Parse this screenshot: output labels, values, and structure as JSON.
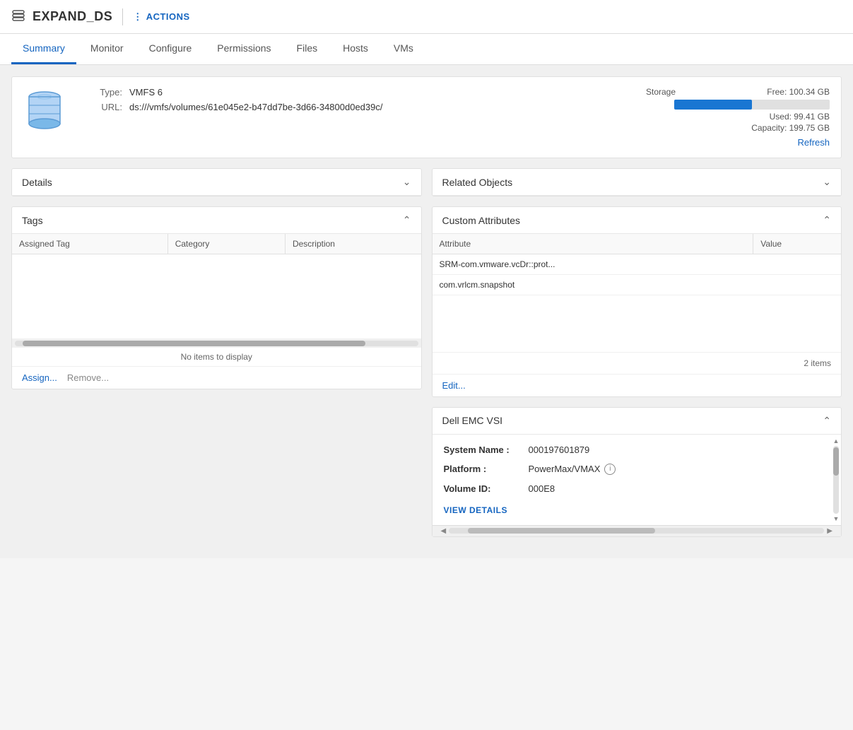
{
  "header": {
    "icon": "database-icon",
    "title": "EXPAND_DS",
    "actions_label": "ACTIONS"
  },
  "nav": {
    "tabs": [
      {
        "label": "Summary",
        "active": true
      },
      {
        "label": "Monitor",
        "active": false
      },
      {
        "label": "Configure",
        "active": false
      },
      {
        "label": "Permissions",
        "active": false
      },
      {
        "label": "Files",
        "active": false
      },
      {
        "label": "Hosts",
        "active": false
      },
      {
        "label": "VMs",
        "active": false
      }
    ]
  },
  "info": {
    "type_label": "Type:",
    "type_value": "VMFS 6",
    "url_label": "URL:",
    "url_value": "ds:///vmfs/volumes/61e045e2-b47dd7be-3d66-34800d0ed39c/",
    "storage_title": "Storage",
    "storage_free": "Free: 100.34 GB",
    "storage_used": "Used: 99.41 GB",
    "storage_capacity": "Capacity: 199.75 GB",
    "storage_fill_percent": 50,
    "refresh_label": "Refresh"
  },
  "details_panel": {
    "title": "Details",
    "collapsed": true
  },
  "related_objects_panel": {
    "title": "Related Objects",
    "collapsed": true
  },
  "tags_panel": {
    "title": "Tags",
    "columns": [
      "Assigned Tag",
      "Category",
      "Description"
    ],
    "rows": [],
    "no_items_text": "No items to display",
    "assign_label": "Assign...",
    "remove_label": "Remove..."
  },
  "custom_attributes_panel": {
    "title": "Custom Attributes",
    "columns": [
      "Attribute",
      "Value"
    ],
    "rows": [
      {
        "attribute": "SRM-com.vmware.vcDr::prot...",
        "value": ""
      },
      {
        "attribute": "com.vrlcm.snapshot",
        "value": ""
      }
    ],
    "items_count": "2 items",
    "edit_label": "Edit..."
  },
  "dell_emc_panel": {
    "title": "Dell EMC VSI",
    "system_name_label": "System Name :",
    "system_name_value": "000197601879",
    "platform_label": "Platform :",
    "platform_value": "PowerMax/VMAX",
    "volume_id_label": "Volume ID:",
    "volume_id_value": "000E8",
    "view_details_label": "VIEW DETAILS"
  }
}
